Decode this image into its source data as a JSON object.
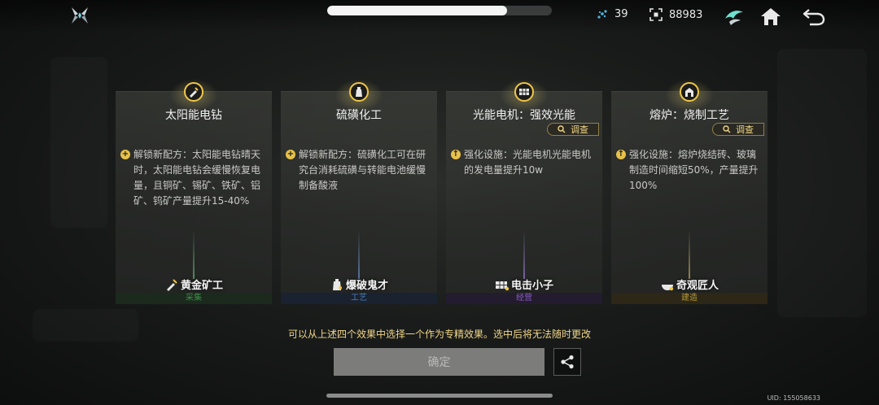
{
  "top": {
    "progress": 0.8,
    "energy_value": "39",
    "coin_value": "88983"
  },
  "cards": [
    {
      "title": "太阳能电钻",
      "description": "解锁新配方：太阳能电钻晴天时，太阳能电钻会缓慢恢复电量，且铜矿、锡矿、铁矿、铝矿、钨矿产量提升15-40%",
      "bullet": "+",
      "badge": "黄金矿工",
      "category": "采集",
      "category_color": "#3f8a4a",
      "category_bg": "#1b2a1d",
      "streak_color": "rgba(130,220,150,0.55)",
      "has_investigate": false
    },
    {
      "title": "硫磺化工",
      "description": "解锁新配方：硫磺化工可在研究台消耗硫磺与转能电池缓慢制备酸液",
      "bullet": "+",
      "badge": "爆破鬼才",
      "category": "工艺",
      "category_color": "#4a7fb8",
      "category_bg": "#1a2230",
      "streak_color": "rgba(130,180,255,0.55)",
      "has_investigate": false
    },
    {
      "title": "光能电机：强效光能",
      "description": "强化设施：光能电机光能电机的发电量提升10w",
      "bullet": "↑",
      "badge": "电击小子",
      "category": "经营",
      "category_color": "#8a5cc7",
      "category_bg": "#231c2e",
      "streak_color": "rgba(190,150,255,0.55)",
      "has_investigate": true
    },
    {
      "title": "熔炉：烧制工艺",
      "description": "强化设施：熔炉烧结砖、玻璃制造时间缩短50%，产量提升100%",
      "bullet": "↑",
      "badge": "奇观匠人",
      "category": "建造",
      "category_color": "#b89a3a",
      "category_bg": "#2c2717",
      "streak_color": "rgba(240,210,120,0.55)",
      "has_investigate": true
    }
  ],
  "investigate_label": "调查",
  "hint": "可以从上述四个效果中选择一个作为专精效果。选中后将无法随时更改",
  "confirm_label": "确定",
  "uid": "UID: 155058633",
  "icons": {
    "logo": "x-logo-icon",
    "energy": "energy-cluster-icon",
    "coin": "coin-frame-icon",
    "bird": "bird-emblem-icon",
    "home": "home-icon",
    "back": "back-arrow-icon",
    "share": "share-icon",
    "search": "search-icon"
  },
  "colors": {
    "accent": "#f0c64a",
    "hint": "#f0d688",
    "confirm_bg": "#7c7d7b"
  }
}
